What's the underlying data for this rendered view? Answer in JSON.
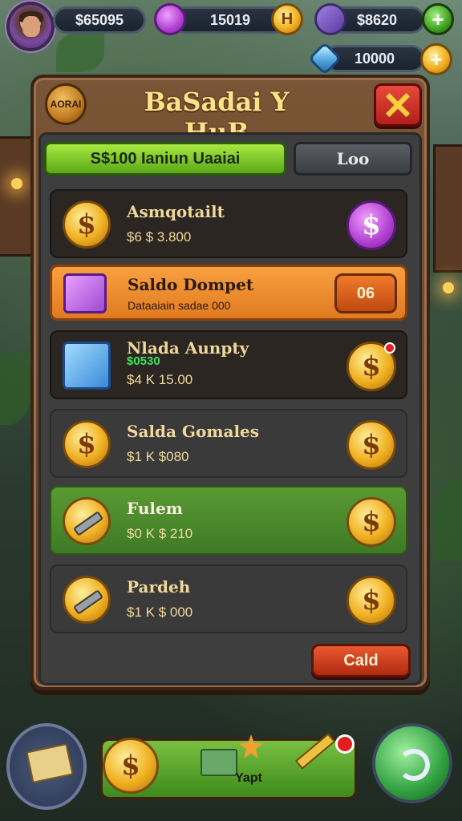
{
  "top_bar": {
    "coins_value": "$65095",
    "gems_value": "15019",
    "gold_plus_label": "H",
    "swords_value": "$8620",
    "plus_label": "+",
    "crystal_value": "10000",
    "gold_plus2_label": "+"
  },
  "panel": {
    "badge_label": "AORAI",
    "title": "BaSadai Y HuB",
    "close_label": "✕",
    "tabs": [
      {
        "label": "S$100 Ianiun Uaaiai",
        "active": true
      },
      {
        "label": "Loo",
        "active": false
      }
    ],
    "items": [
      {
        "name": "Asmqotailt",
        "sub": "$6 $ 3.800",
        "extra": "",
        "style": "dark-brown"
      },
      {
        "name": "Saldo Dompet",
        "sub": "Dataaiain sadae 000",
        "extra": "",
        "button": "06",
        "style": "orange"
      },
      {
        "name": "Nlada Aunpty",
        "sub": "$4 K 15.00",
        "extra": "$0530",
        "style": "dark-brown"
      },
      {
        "name": "Salda Gomales",
        "sub": "$1 K $080",
        "extra": "",
        "style": "dark"
      },
      {
        "name": "Fulem",
        "sub": "$0 K $ 210",
        "extra": "",
        "style": "green"
      },
      {
        "name": "Pardeh",
        "sub": "$1 K $ 000",
        "extra": "",
        "style": "dark"
      }
    ],
    "call_button": "Cald"
  },
  "bottom_bar": {
    "center_label": "Yapt"
  },
  "colors": {
    "accent_green": "#5aa818",
    "accent_orange": "#e07a20",
    "gold": "#f0b020",
    "panel_wood": "#6a4a2e"
  }
}
